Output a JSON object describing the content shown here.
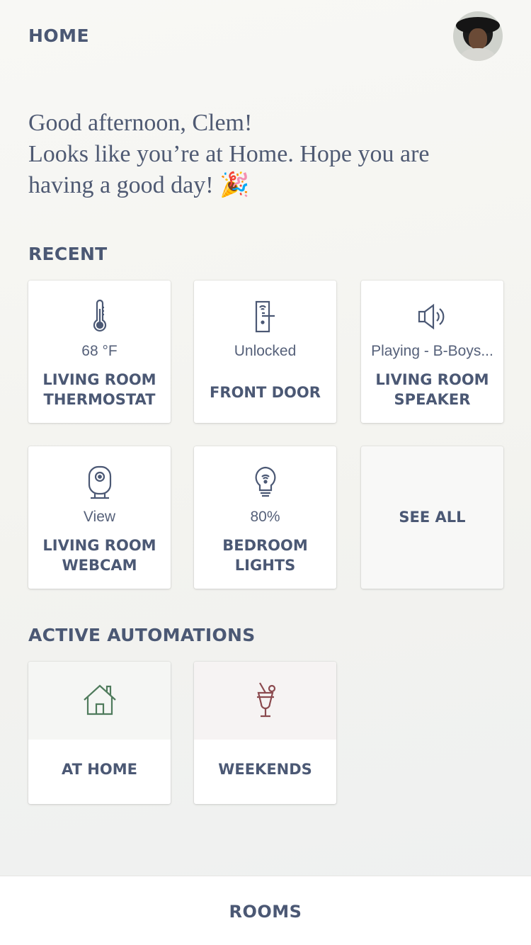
{
  "header": {
    "title": "HOME"
  },
  "greeting": {
    "line1": "Good afternoon, Clem!",
    "line2": "Looks like you’re at Home. Hope you are",
    "line3": "having a good day! 🎉"
  },
  "recent": {
    "title": "RECENT",
    "devices": [
      {
        "icon": "thermometer-icon",
        "status": "68 °F",
        "name": "LIVING ROOM THERMOSTAT"
      },
      {
        "icon": "door-lock-icon",
        "status": "Unlocked",
        "name": "FRONT DOOR"
      },
      {
        "icon": "speaker-icon",
        "status": "Playing - B-Boys...",
        "name": "LIVING ROOM SPEAKER"
      },
      {
        "icon": "webcam-icon",
        "status": "View",
        "name": "LIVING ROOM WEBCAM"
      },
      {
        "icon": "lightbulb-icon",
        "status": "80%",
        "name": "BEDROOM LIGHTS"
      }
    ],
    "see_all_label": "SEE ALL"
  },
  "automations": {
    "title": "ACTIVE AUTOMATIONS",
    "items": [
      {
        "icon": "house-icon",
        "name": "AT HOME",
        "color": "#4f7b5c",
        "bg": "#f5f6f4"
      },
      {
        "icon": "cocktail-icon",
        "name": "WEEKENDS",
        "color": "#8b4a4f",
        "bg": "#f6f3f3"
      }
    ]
  },
  "bottom_nav": {
    "rooms_label": "ROOMS"
  },
  "colors": {
    "text": "#4b5874",
    "card": "#ffffff"
  }
}
